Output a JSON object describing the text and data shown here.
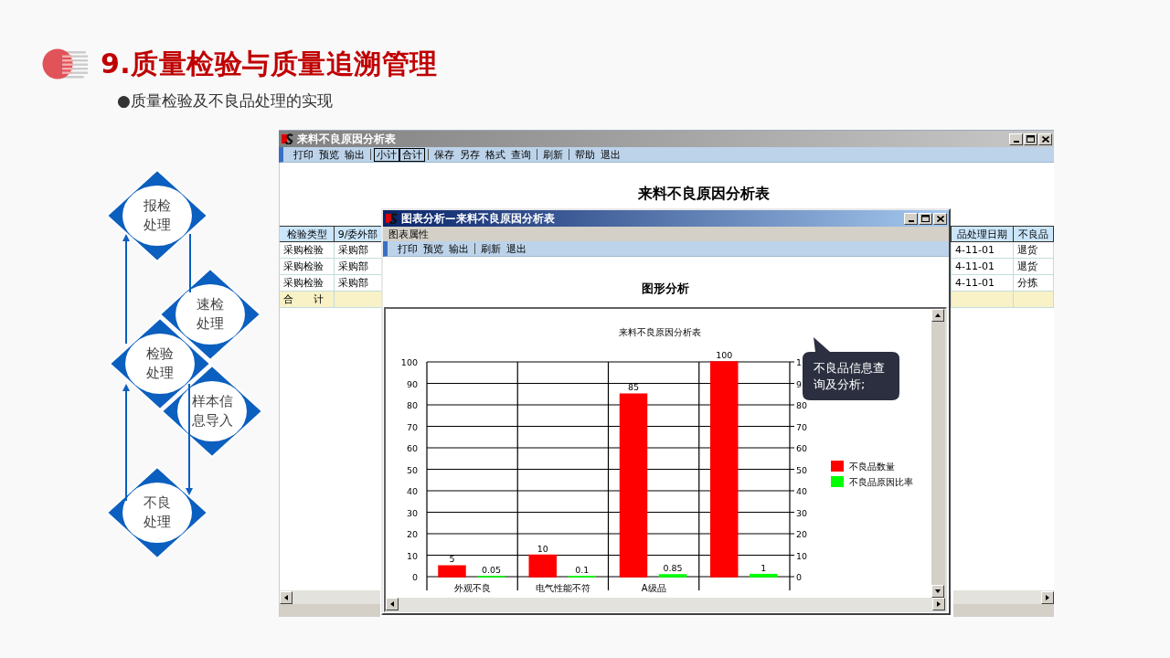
{
  "slide": {
    "title": "9.质量检验与质量追溯管理",
    "bullet": "●质量检验及不良品处理的实现"
  },
  "flow": {
    "nodes": [
      {
        "label": "报检处理"
      },
      {
        "label": "速检处理"
      },
      {
        "label": "检验处理"
      },
      {
        "label": "样本信息导入"
      },
      {
        "label": "不良处理"
      }
    ]
  },
  "report_window": {
    "title": "来料不良原因分析表",
    "toolbar": [
      {
        "kind": "item",
        "label": "打印"
      },
      {
        "kind": "item",
        "label": "预览"
      },
      {
        "kind": "item",
        "label": "输出"
      },
      {
        "kind": "separator"
      },
      {
        "kind": "boxed",
        "label": "小计"
      },
      {
        "kind": "boxed",
        "label": "合计"
      },
      {
        "kind": "separator"
      },
      {
        "kind": "item",
        "label": "保存"
      },
      {
        "kind": "item",
        "label": "另存"
      },
      {
        "kind": "item",
        "label": "格式"
      },
      {
        "kind": "item",
        "label": "查询"
      },
      {
        "kind": "separator"
      },
      {
        "kind": "item",
        "label": "刷新"
      },
      {
        "kind": "separator"
      },
      {
        "kind": "item",
        "label": "帮助"
      },
      {
        "kind": "item",
        "label": "退出"
      }
    ],
    "report_title": "来料不良原因分析表",
    "table": {
      "columns": [
        "检验类型",
        "9/委外部",
        "品处理日期",
        "不良品"
      ],
      "rows": [
        [
          "采购检验",
          "采购部",
          "4-11-01",
          "退货"
        ],
        [
          "采购检验",
          "采购部",
          "4-11-01",
          "退货"
        ],
        [
          "采购检验",
          "采购部",
          "4-11-01",
          "分拣"
        ]
      ],
      "total_label": "合　　计"
    }
  },
  "chart_window": {
    "title": "图表分析—来料不良原因分析表",
    "menu": [
      "图表属性"
    ],
    "toolbar": [
      {
        "kind": "item",
        "label": "打印"
      },
      {
        "kind": "item",
        "label": "预览"
      },
      {
        "kind": "item",
        "label": "输出"
      },
      {
        "kind": "separator"
      },
      {
        "kind": "item",
        "label": "刷新"
      },
      {
        "kind": "item",
        "label": "退出"
      }
    ],
    "heading": "图形分析",
    "chart_data": {
      "type": "bar",
      "title": "来料不良原因分析表",
      "categories": [
        "外观不良",
        "电气性能不符",
        "A级品",
        null
      ],
      "series": [
        {
          "name": "不良品数量",
          "color": "#ff0000",
          "values": [
            5,
            10,
            85,
            100
          ]
        },
        {
          "name": "不良品原因比率",
          "color": "#00ff00",
          "values": [
            0.05,
            0.1,
            0.85,
            1
          ]
        }
      ],
      "ylim": [
        0,
        100
      ],
      "yticks": [
        0,
        10,
        20,
        30,
        40,
        50,
        60,
        70,
        80,
        90,
        100
      ],
      "grid": true,
      "legend": true,
      "data_labels": true
    },
    "right_axis_labels": [
      "1",
      "9",
      "80",
      "70",
      "60",
      "50",
      "40",
      "30",
      "20",
      "10",
      "0"
    ]
  },
  "callout": {
    "text": "不良品信息查询及分析;"
  }
}
